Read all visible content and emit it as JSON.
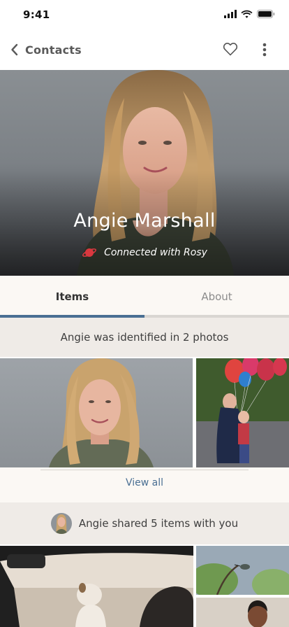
{
  "status_bar": {
    "time": "9:41"
  },
  "nav": {
    "back_label": "Contacts"
  },
  "profile": {
    "name": "Angie Marshall",
    "connection": "Connected with Rosy"
  },
  "tabs": [
    {
      "label": "Items",
      "selected": true
    },
    {
      "label": "About",
      "selected": false
    }
  ],
  "identified": {
    "heading": "Angie was identified in 2 photos",
    "view_all": "View all"
  },
  "shared": {
    "heading": "Angie shared 5 items with you"
  },
  "colors": {
    "accent": "#4a6f93",
    "section_bg": "#efebe7",
    "connection_icon": "#d9383f"
  }
}
